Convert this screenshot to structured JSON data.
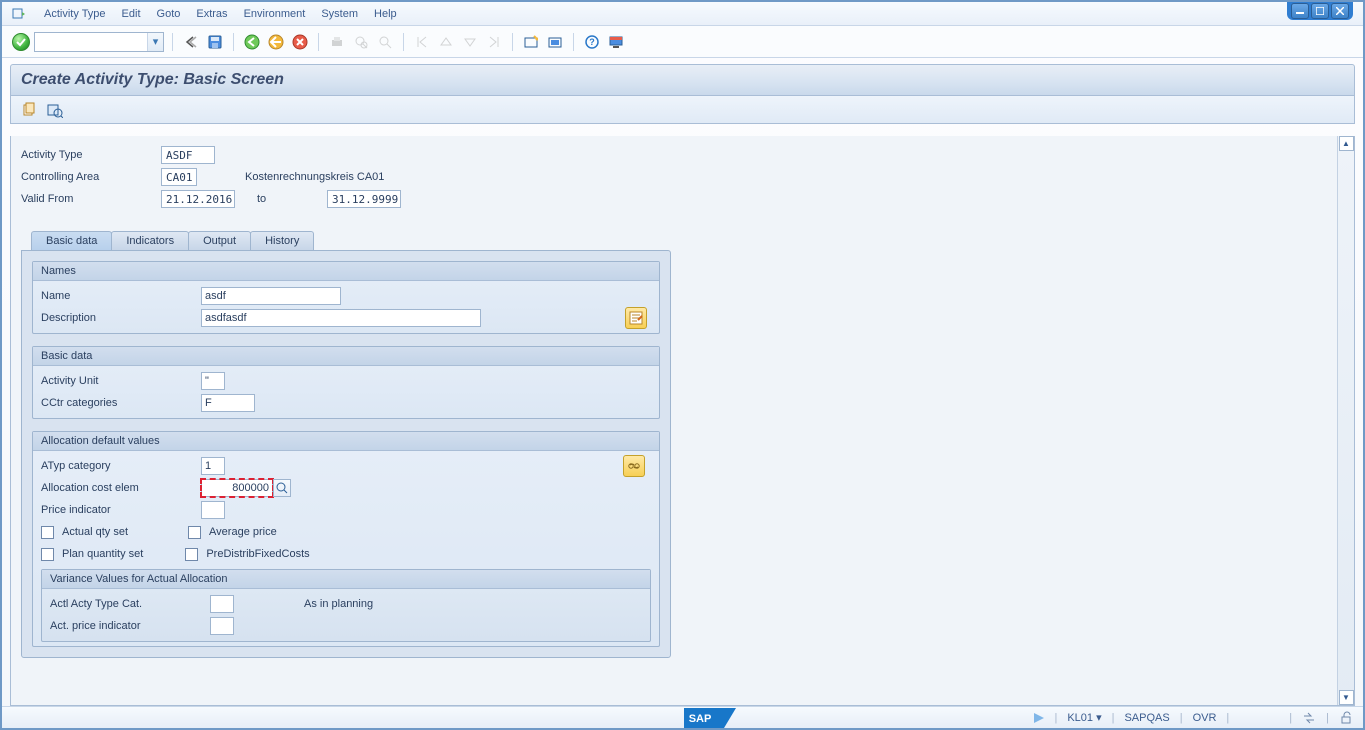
{
  "menu": {
    "items": [
      "Activity Type",
      "Edit",
      "Goto",
      "Extras",
      "Environment",
      "System",
      "Help"
    ]
  },
  "title": "Create Activity Type: Basic Screen",
  "header": {
    "activityTypeLabel": "Activity Type",
    "activityType": "ASDF",
    "controllingAreaLabel": "Controlling Area",
    "controllingArea": "CA01",
    "controllingAreaText": "Kostenrechnungskreis CA01",
    "validFromLabel": "Valid From",
    "validFrom": "21.12.2016",
    "toLabel": "to",
    "validTo": "31.12.9999"
  },
  "tabs": [
    "Basic data",
    "Indicators",
    "Output",
    "History"
  ],
  "names": {
    "frameTitle": "Names",
    "nameLabel": "Name",
    "name": "asdf",
    "descLabel": "Description",
    "desc": "asdfasdf"
  },
  "basic": {
    "frameTitle": "Basic data",
    "unitLabel": "Activity Unit",
    "unit": "\"",
    "cctrLabel": "CCtr categories",
    "cctr": "F"
  },
  "alloc": {
    "frameTitle": "Allocation default values",
    "atypLabel": "ATyp category",
    "atyp": "1",
    "aceLabel": "Allocation cost elem",
    "ace": "800000",
    "priceIndLabel": "Price indicator",
    "priceInd": "",
    "chkActualQty": "Actual qty set",
    "chkAvgPrice": "Average price",
    "chkPlanQty": "Plan quantity set",
    "chkPreDistrib": "PreDistribFixedCosts",
    "varianceTitle": "Variance Values for Actual Allocation",
    "actlCatLabel": "Actl Acty Type Cat.",
    "actlCat": "",
    "asInPlanning": "As in planning",
    "actPriceIndLabel": "Act. price indicator",
    "actPriceInd": ""
  },
  "status": {
    "session": "KL01",
    "server": "SAPQAS",
    "mode": "OVR"
  }
}
